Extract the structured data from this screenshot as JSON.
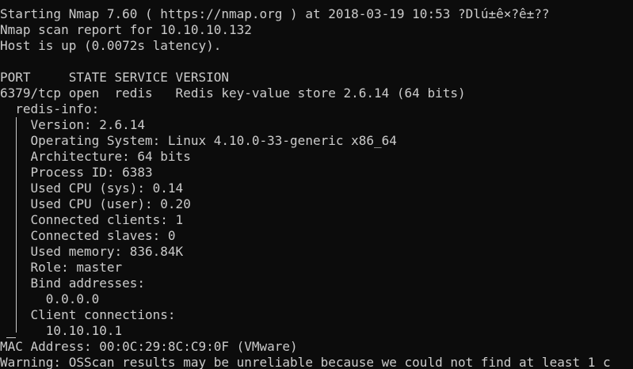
{
  "colors": {
    "background": "#0c0c0c",
    "text": "#cccccc"
  },
  "terminal": {
    "lines": [
      "Starting Nmap 7.60 ( https://nmap.org ) at 2018-03-19 10:53 ?Dlú±ê×?ê±??",
      "Nmap scan report for 10.10.10.132",
      "Host is up (0.0072s latency).",
      "",
      "PORT     STATE SERVICE VERSION",
      "6379/tcp open  redis   Redis key-value store 2.6.14 (64 bits)",
      "  redis-info:",
      "    Version: 2.6.14",
      "    Operating System: Linux 4.10.0-33-generic x86_64",
      "    Architecture: 64 bits",
      "    Process ID: 6383",
      "    Used CPU (sys): 0.14",
      "    Used CPU (user): 0.20",
      "    Connected clients: 1",
      "    Connected slaves: 0",
      "    Used memory: 836.84K",
      "    Role: master",
      "    Bind addresses:",
      "      0.0.0.0",
      "    Client connections:",
      "      10.10.10.1",
      "MAC Address: 00:0C:29:8C:C9:0F (VMware)",
      "Warning: OSScan results may be unreliable because we could not find at least 1 c"
    ]
  }
}
